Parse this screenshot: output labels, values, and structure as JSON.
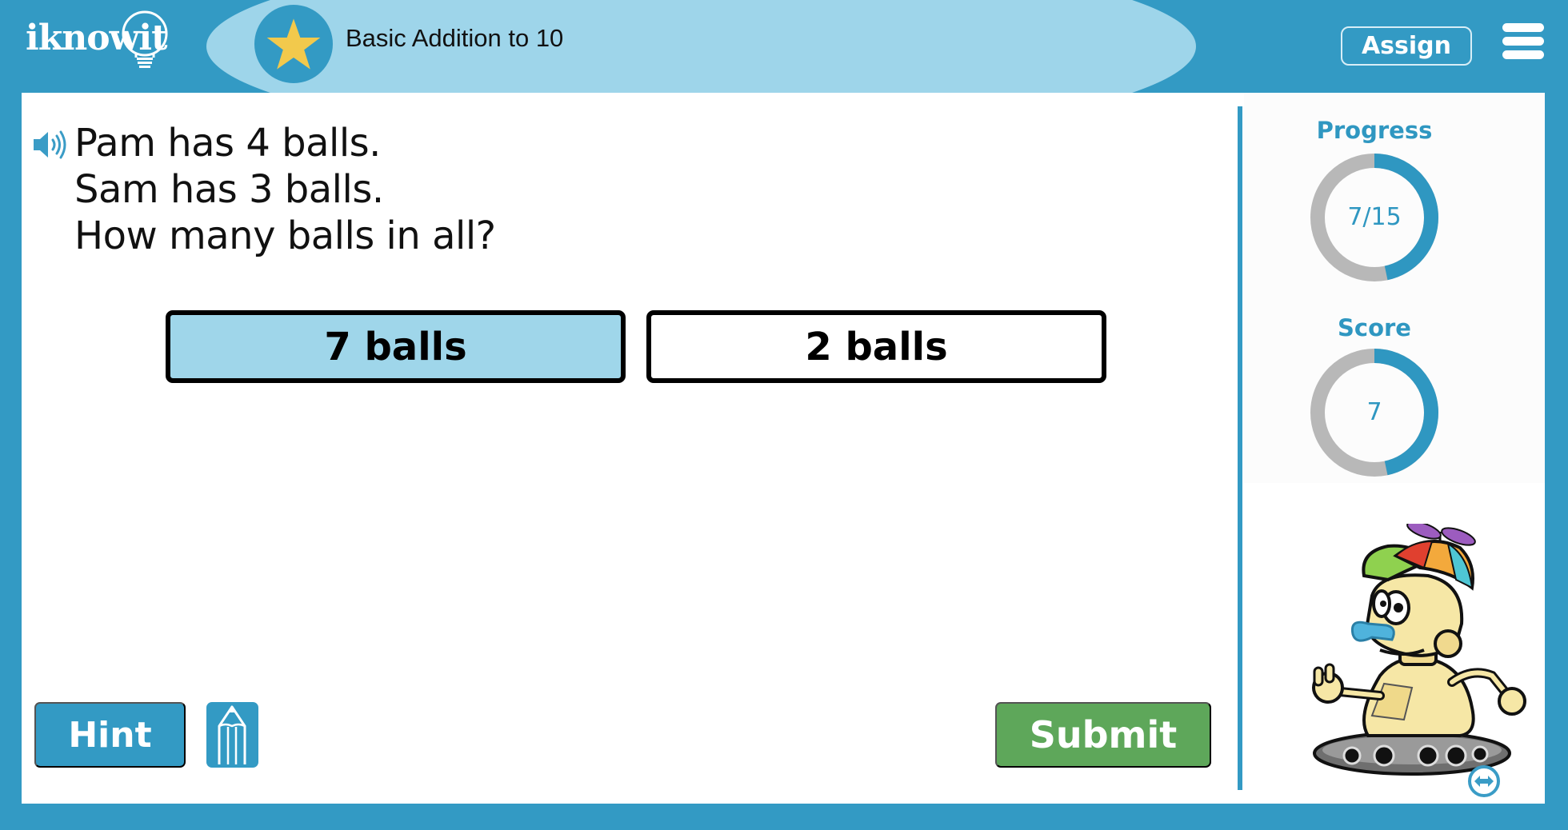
{
  "header": {
    "logo_text": "iknowit",
    "title": "Basic Addition to 10",
    "badge_icon": "star-icon",
    "assign_label": "Assign",
    "menu_icon": "hamburger-menu-icon"
  },
  "question": {
    "audio_icon": "speaker-icon",
    "lines": [
      "Pam has 4 balls.",
      "Sam has 3 balls.",
      "How many balls in all?"
    ]
  },
  "answers": [
    {
      "label": "7 balls",
      "selected": true
    },
    {
      "label": "2 balls",
      "selected": false
    }
  ],
  "footer": {
    "hint_label": "Hint",
    "scratchpad_icon": "pencil-icon",
    "submit_label": "Submit"
  },
  "stats": {
    "progress": {
      "label": "Progress",
      "text": "7/15",
      "current": 7,
      "total": 15
    },
    "score": {
      "label": "Score",
      "text": "7",
      "fraction": 0.4667
    }
  },
  "mascot": {
    "name": "robot-mascot",
    "swap_icon": "swap-arrows-icon"
  },
  "colors": {
    "brand_blue": "#339ac4",
    "light_blue": "#9ed5ea",
    "selected_answer": "#9fd6ea",
    "submit_green": "#5ea75a",
    "star_yellow": "#f2c94c",
    "ring_gray": "#b8b8b8",
    "ring_blue": "#2f97c1"
  }
}
